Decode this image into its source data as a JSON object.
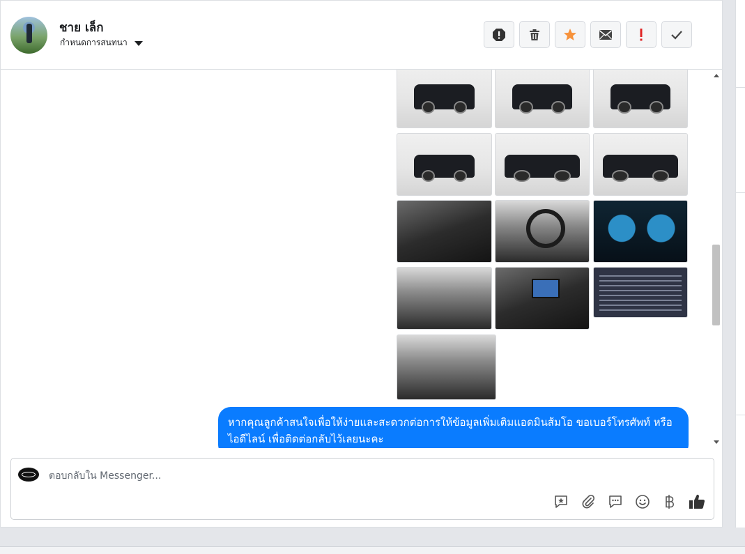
{
  "header": {
    "contact_name": "ชาย เล็ก",
    "conversation_settings": "กำหนดการสนทนา",
    "actions": [
      {
        "name": "report-spam",
        "icon": "exclamation-circle-icon"
      },
      {
        "name": "delete",
        "icon": "trash-icon"
      },
      {
        "name": "star",
        "icon": "star-icon",
        "color": "#f7923b"
      },
      {
        "name": "mark-unread",
        "icon": "envelope-icon"
      },
      {
        "name": "mark-important",
        "icon": "exclamation-icon",
        "color": "#e02424"
      },
      {
        "name": "mark-done",
        "icon": "check-icon"
      }
    ]
  },
  "conversation": {
    "photos": [
      {
        "kind": "truck-front"
      },
      {
        "kind": "truck-front"
      },
      {
        "kind": "truck-rear"
      },
      {
        "kind": "truck-rear"
      },
      {
        "kind": "truck-side"
      },
      {
        "kind": "truck-side"
      },
      {
        "kind": "door-interior"
      },
      {
        "kind": "steering-wheel"
      },
      {
        "kind": "dashboard-gauges"
      },
      {
        "kind": "cabin-interior"
      },
      {
        "kind": "center-console"
      },
      {
        "kind": "spec-document"
      },
      {
        "kind": "rear-seat"
      }
    ],
    "message": "หากคุณลูกค้าสนใจเพื่อให้ง่ายและสะดวกต่อการให้ข้อมูลเพิ่มเติมแอดมินส้มโอ ขอเบอร์โทรศัพท์ หรือ ไอดีไลน์ เพื่อติดต่อกลับไว้เลยนะคะ",
    "bubble_color": "#0a7cff"
  },
  "composer": {
    "placeholder": "ตอบกลับใน Messenger...",
    "tools": [
      "saved-reply-icon",
      "attachment-icon",
      "message-options-icon",
      "emoji-icon",
      "baht-icon",
      "like-icon"
    ]
  }
}
